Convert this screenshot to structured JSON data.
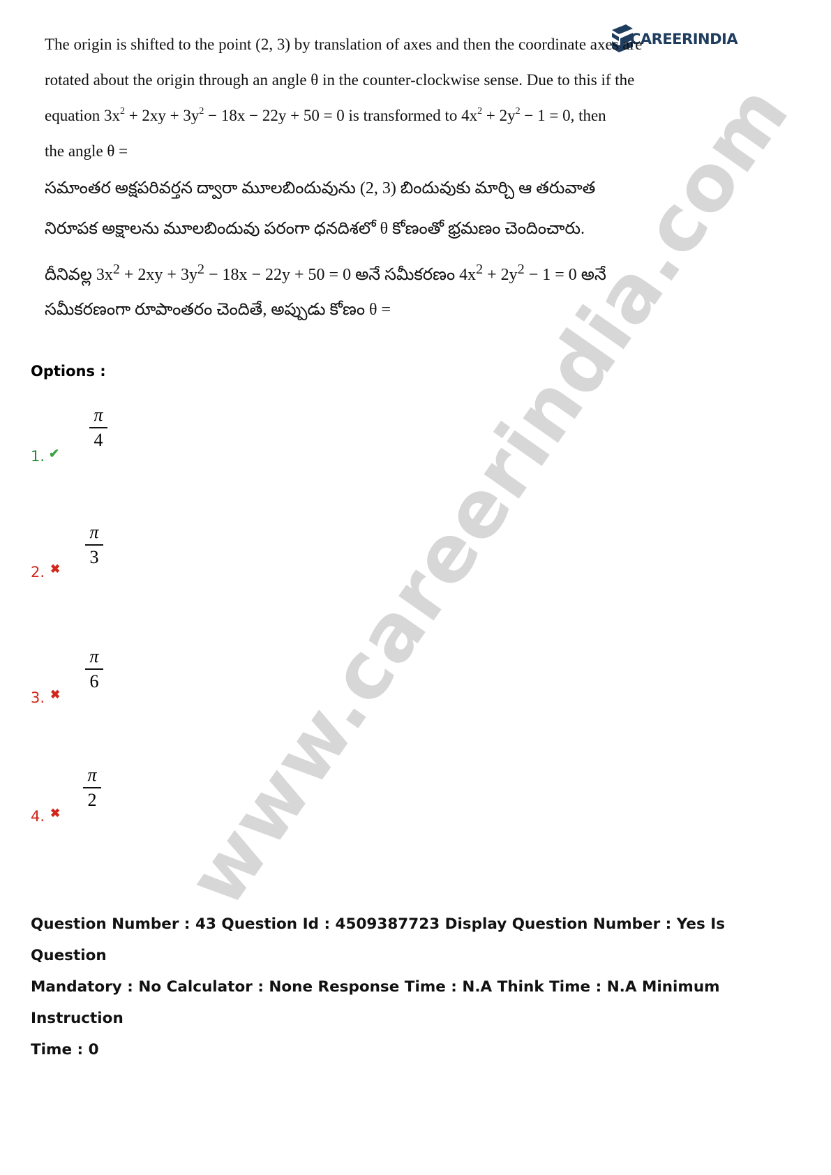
{
  "logo": {
    "text_main": "CAREER",
    "text_accent": "INDIA"
  },
  "watermark": "www.careerindia.com",
  "question": {
    "en_line1": "The origin is shifted to the point (2, 3) by translation of axes and then the coordinate axes are",
    "en_line2": "rotated about the origin through an angle θ in the counter-clockwise sense. Due to this if the",
    "en_line3_pre": "equation 3x",
    "en_line3_mid1": " + 2xy + 3y",
    "en_line3_mid2": " − 18x − 22y + 50 = 0   is transformed to 4x",
    "en_line3_mid3": " + 2y",
    "en_line3_post": " − 1 = 0, then",
    "en_line4": "the angle θ =",
    "te_line1": "సమాంతర అక్షపరివర్తన ద్వారా మూలబిందువును (2, 3) బిందువుకు మార్చి ఆ తరువాత",
    "te_line2": "నిరూపక అక్షాలను మూలబిందువు పరంగా ధనదిశలో θ కోణంతో భ్రమణం చెందించారు.",
    "te_line3_pre": "దీనివల్ల  3x",
    "te_line3_mid1": " + 2xy + 3y",
    "te_line3_mid2": " − 18x − 22y + 50 = 0 అనే సమీకరణం  4x",
    "te_line3_mid3": " + 2y",
    "te_line3_post": " − 1 = 0 అనే",
    "te_line4": "సమీకరణంగా రూపాంతరం చెందితే, అప్పుడు కోణం θ =",
    "sup": "2"
  },
  "options_label": "Options :",
  "options": [
    {
      "num": "1.",
      "status": "correct",
      "mark": "✔",
      "numerator": "π",
      "denominator": "4"
    },
    {
      "num": "2.",
      "status": "wrong",
      "mark": "✖",
      "numerator": "π",
      "denominator": "3"
    },
    {
      "num": "3.",
      "status": "wrong",
      "mark": "✖",
      "numerator": "π",
      "denominator": "6"
    },
    {
      "num": "4.",
      "status": "wrong",
      "mark": "✖",
      "numerator": "π",
      "denominator": "2"
    }
  ],
  "meta": {
    "line1": "Question Number : 43 Question Id : 4509387723 Display Question Number : Yes Is Question",
    "line2": "Mandatory : No Calculator : None Response Time : N.A Think Time : N.A Minimum Instruction",
    "line3": "Time : 0"
  },
  "colors": {
    "correct": "#1f8b2a",
    "wrong": "#d2261b",
    "logo": "#1f3d5f"
  }
}
